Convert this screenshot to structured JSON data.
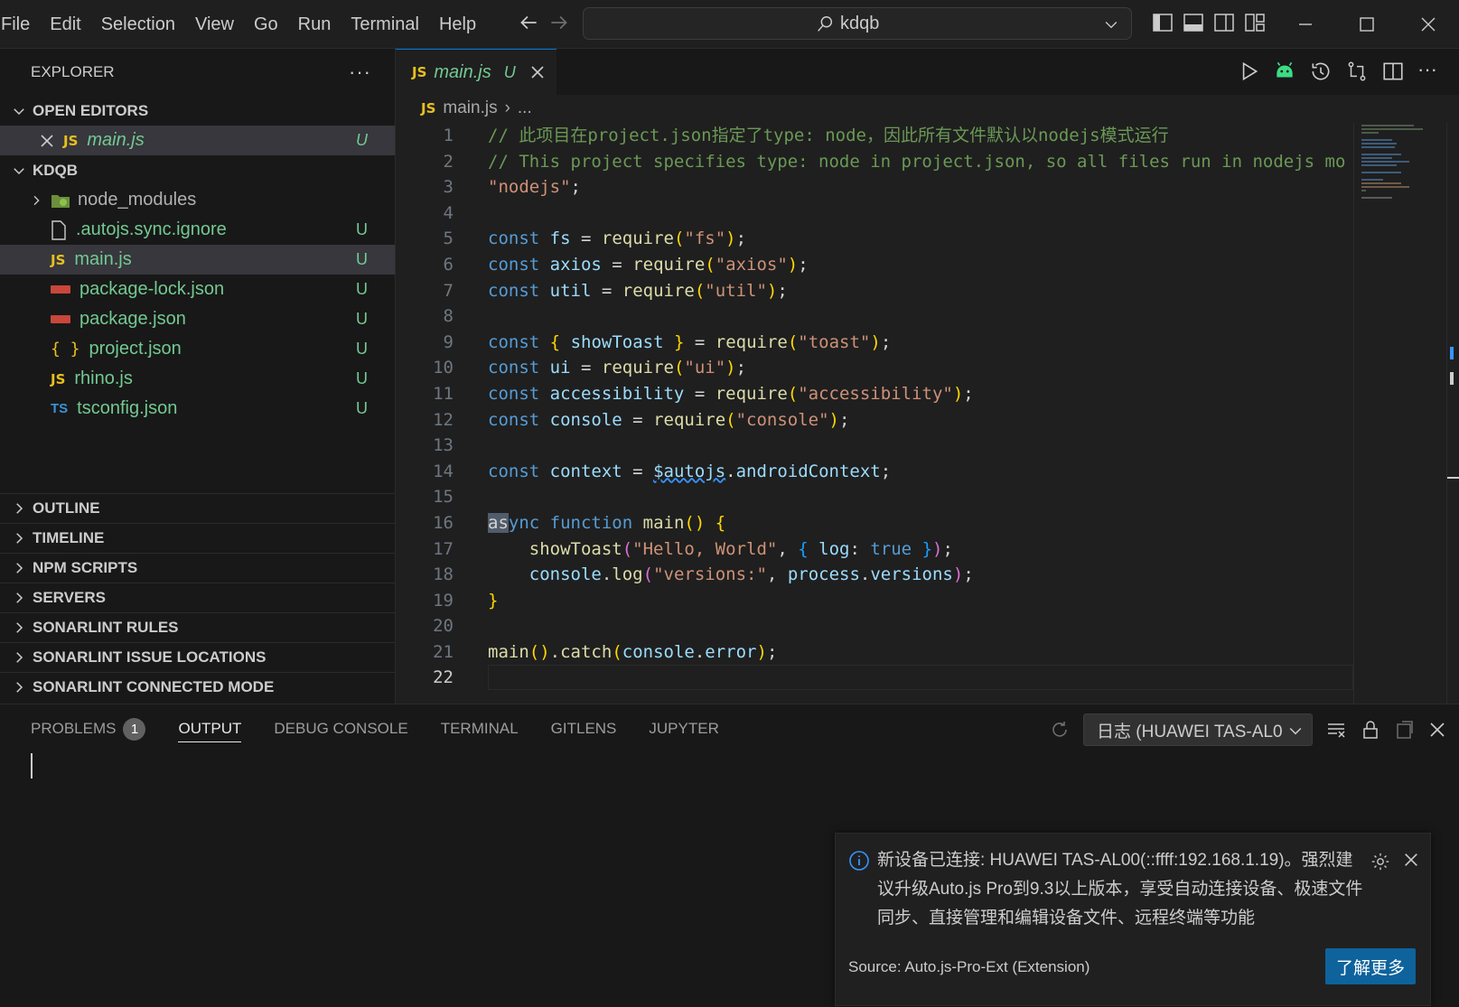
{
  "menu": [
    "File",
    "Edit",
    "Selection",
    "View",
    "Go",
    "Run",
    "Terminal",
    "Help"
  ],
  "command_center": {
    "text": "kdqb"
  },
  "sidebar": {
    "title": "EXPLORER",
    "open_editors": {
      "label": "OPEN EDITORS",
      "items": [
        {
          "icon": "JS",
          "name": "main.js",
          "status": "U"
        }
      ]
    },
    "project": {
      "label": "KDQB",
      "items": [
        {
          "icon": "folder",
          "name": "node_modules",
          "status": ""
        },
        {
          "icon": "file",
          "name": ".autojs.sync.ignore",
          "status": "U"
        },
        {
          "icon": "JS",
          "name": "main.js",
          "status": "U"
        },
        {
          "icon": "npm",
          "name": "package-lock.json",
          "status": "U"
        },
        {
          "icon": "npm",
          "name": "package.json",
          "status": "U"
        },
        {
          "icon": "{ }",
          "name": "project.json",
          "status": "U"
        },
        {
          "icon": "JS",
          "name": "rhino.js",
          "status": "U"
        },
        {
          "icon": "TS",
          "name": "tsconfig.json",
          "status": "U"
        }
      ]
    },
    "sections": [
      "OUTLINE",
      "TIMELINE",
      "NPM SCRIPTS",
      "SERVERS",
      "SONARLINT RULES",
      "SONARLINT ISSUE LOCATIONS",
      "SONARLINT CONNECTED MODE"
    ]
  },
  "editor": {
    "tab": {
      "icon": "JS",
      "title": "main.js",
      "status": "U"
    },
    "breadcrumb": {
      "icon": "JS",
      "file": "main.js",
      "rest": "..."
    },
    "line_numbers": [
      "1",
      "2",
      "3",
      "4",
      "5",
      "6",
      "7",
      "8",
      "9",
      "10",
      "11",
      "12",
      "13",
      "14",
      "15",
      "16",
      "17",
      "18",
      "19",
      "20",
      "21",
      "22"
    ],
    "active_line": 22
  },
  "panel": {
    "tabs": [
      {
        "label": "PROBLEMS",
        "badge": "1"
      },
      {
        "label": "OUTPUT",
        "badge": ""
      },
      {
        "label": "DEBUG CONSOLE",
        "badge": ""
      },
      {
        "label": "TERMINAL",
        "badge": ""
      },
      {
        "label": "GITLENS",
        "badge": ""
      },
      {
        "label": "JUPYTER",
        "badge": ""
      }
    ],
    "active_tab": "OUTPUT",
    "channel": "日志 (HUAWEI TAS-AL0"
  },
  "notification": {
    "message": "新设备已连接: HUAWEI TAS-AL00(::ffff:192.168.1.19)。强烈建议升级Auto.js Pro到9.3以上版本，享受自动连接设备、极速文件同步、直接管理和编辑设备文件、远程终端等功能",
    "source": "Source: Auto.js-Pro-Ext (Extension)",
    "button": "了解更多"
  },
  "colors": {
    "accent": "#0078d4",
    "git_untracked": "#73c991",
    "button": "#0e639c"
  }
}
